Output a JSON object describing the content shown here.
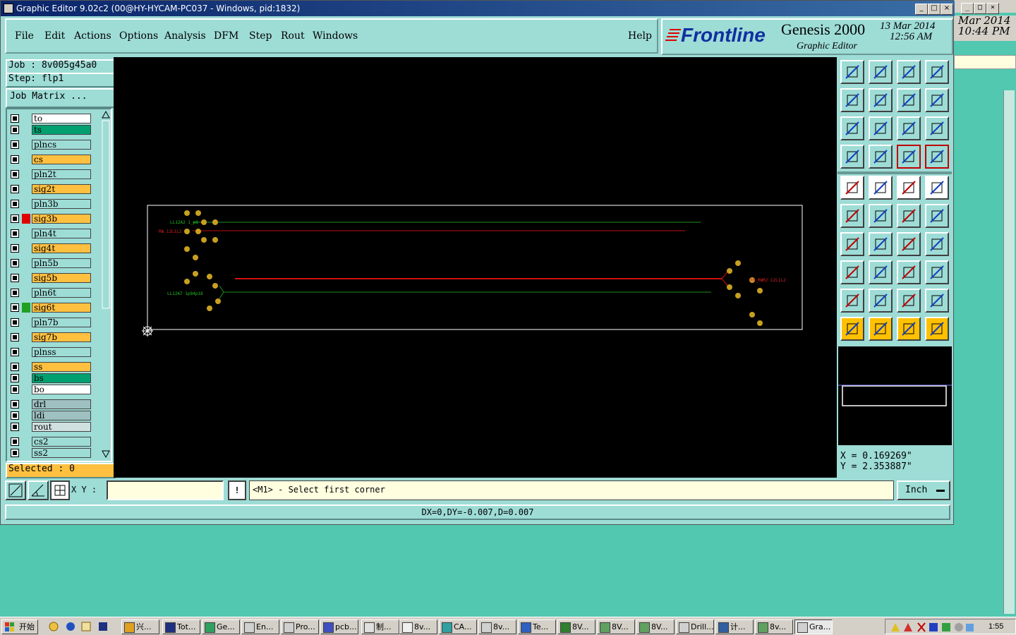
{
  "window": {
    "title": "Graphic Editor 9.02c2 (00@HY-HYCAM-PC037 - Windows, pid:1832)",
    "controls": [
      "_",
      "□",
      "×"
    ]
  },
  "back_window": {
    "date": "Mar 2014",
    "time": "10:44 PM"
  },
  "menu": {
    "items": [
      "File",
      "Edit",
      "Actions",
      "Options",
      "Analysis",
      "DFM",
      "Step",
      "Rout",
      "Windows"
    ],
    "help": "Help"
  },
  "brand": {
    "logo": "Frontline",
    "product": "Genesis 2000",
    "subtitle": "Graphic Editor",
    "date": "13 Mar 2014",
    "time": "12:56 AM"
  },
  "job": {
    "job_label": "Job : 8v005g45a0",
    "step_label": "Step: flp1",
    "matrix_button": "Job Matrix ..."
  },
  "layers": [
    {
      "name": "to",
      "color": "#ffffff"
    },
    {
      "name": "ts",
      "color": "#00a070"
    },
    {
      "name": "plncs",
      "color": "#9edcd6"
    },
    {
      "name": "cs",
      "color": "#ffc040"
    },
    {
      "name": "pln2t",
      "color": "#9edcd6"
    },
    {
      "name": "sig2t",
      "color": "#ffc040"
    },
    {
      "name": "pln3b",
      "color": "#9edcd6"
    },
    {
      "name": "sig3b",
      "color": "#ffc040"
    },
    {
      "name": "pln4t",
      "color": "#9edcd6"
    },
    {
      "name": "sig4t",
      "color": "#ffc040"
    },
    {
      "name": "pln5b",
      "color": "#9edcd6"
    },
    {
      "name": "sig5b",
      "color": "#ffc040"
    },
    {
      "name": "pln6t",
      "color": "#9edcd6"
    },
    {
      "name": "sig6t",
      "color": "#ffc040"
    },
    {
      "name": "pln7b",
      "color": "#9edcd6"
    },
    {
      "name": "sig7b",
      "color": "#ffc040"
    },
    {
      "name": "plnss",
      "color": "#9edcd6"
    },
    {
      "name": "ss",
      "color": "#ffc040"
    },
    {
      "name": "bs",
      "color": "#00a070"
    },
    {
      "name": "bo",
      "color": "#ffffff"
    },
    {
      "name": "drl",
      "color": "#9ec0c0"
    },
    {
      "name": "ldi",
      "color": "#9ec0c0"
    },
    {
      "name": "rout",
      "color": "#d0e0e0"
    },
    {
      "name": "cs2",
      "color": "#9edcd6"
    },
    {
      "name": "ss2",
      "color": "#9edcd6"
    }
  ],
  "selected": "Selected : 0",
  "coords": {
    "x": "X = 0.169269\"",
    "y": "Y = 2.353887\""
  },
  "status": {
    "xy_label": "X Y :",
    "xy_value": "",
    "exclaim": "!",
    "prompt": "<M1> - Select first corner",
    "units": "Inch"
  },
  "measure": "DX=0,DY=-0.007,D=0.007",
  "canvas_labels": {
    "label_green_top": "LL12A2 1_p8",
    "label_red_top": "RW 12L1L2",
    "label_green_mid": "LL12A7 1p84p18",
    "label_red_right": "RR_RWR2 12L1L2"
  },
  "taskbar": {
    "start": "开始",
    "tasks": [
      "兴...",
      "Tot...",
      "Ge...",
      "En...",
      "Pro...",
      "pcb...",
      "制...",
      "8v...",
      "CA...",
      "8v...",
      "Te...",
      "8V...",
      "8V...",
      "8V...",
      "Drill...",
      "计...",
      "8v...",
      "Gra..."
    ],
    "clock": "1:55"
  },
  "colors": {
    "panel": "#9edcd6",
    "desktop": "#52c8b0",
    "canvas": "#000000"
  }
}
